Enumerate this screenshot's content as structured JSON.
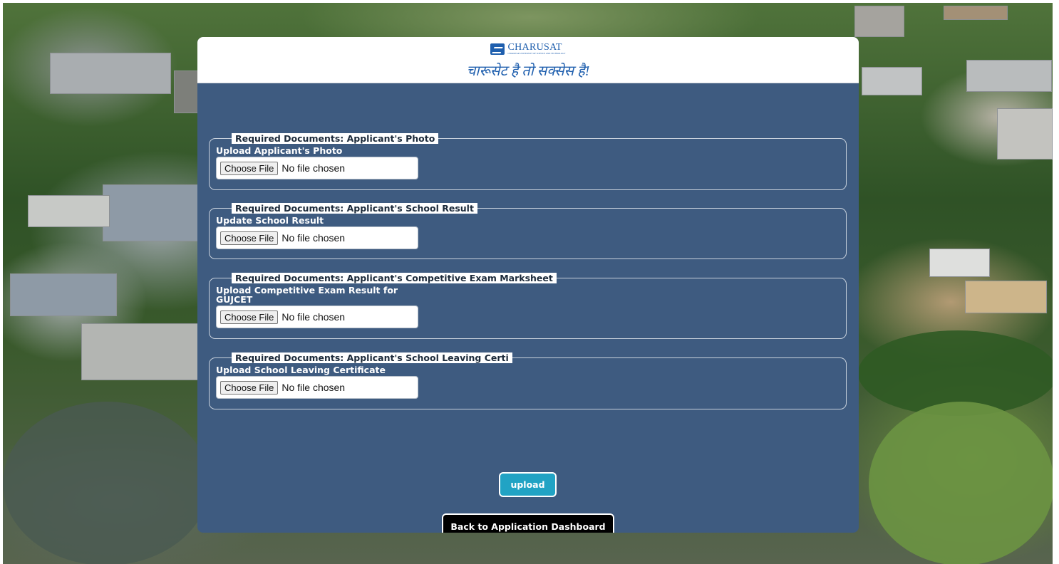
{
  "brand": {
    "name": "CHARUSAT",
    "subname": "CHAROTAR UNIVERSITY OF SCIENCE AND TECHNOLOGY",
    "tagline": "चारूसेट है तो सक्सेस है!",
    "primary_color": "#1f5fae"
  },
  "panel_color": "#3e5b80",
  "sections": [
    {
      "legend": "Required Documents: Applicant's Photo",
      "label": "Upload Applicant's Photo",
      "button": "Choose File",
      "status": "No file chosen"
    },
    {
      "legend": "Required Documents: Applicant's School Result",
      "label": "Update School Result",
      "button": "Choose File",
      "status": "No file chosen"
    },
    {
      "legend": "Required Documents: Applicant's Competitive Exam Marksheet",
      "label": "Upload Competitive Exam Result for GUJCET",
      "button": "Choose File",
      "status": "No file chosen"
    },
    {
      "legend": "Required Documents: Applicant's School Leaving Certi",
      "label": "Upload School Leaving Certificate",
      "button": "Choose File",
      "status": "No file chosen"
    }
  ],
  "actions": {
    "upload_label": "upload",
    "upload_color": "#21a3c4",
    "back_label": "Back to Application Dashboard"
  }
}
